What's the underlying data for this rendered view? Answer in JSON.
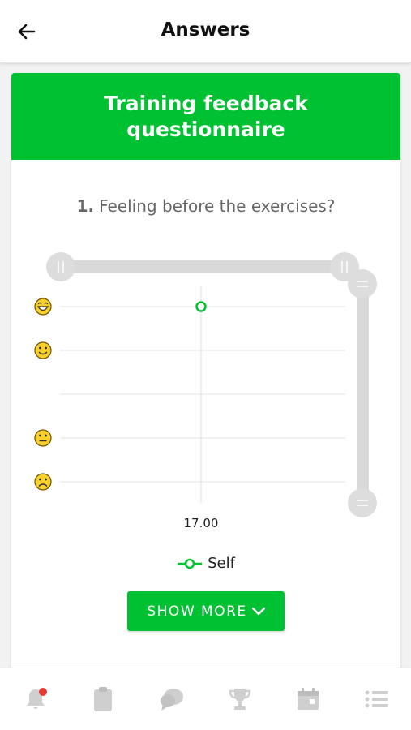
{
  "header": {
    "title": "Answers",
    "back_icon": "arrow-left-icon"
  },
  "card": {
    "title": "Training feedback questionnaire",
    "accent_color": "#00c132"
  },
  "question": {
    "number": "1.",
    "text": "Feeling before the exercises?"
  },
  "chart_data": {
    "type": "scatter",
    "x_ticks": [
      "17.00"
    ],
    "y_levels": [
      {
        "icon": "grinning-face-icon"
      },
      {
        "icon": "smiling-face-icon"
      },
      {
        "icon": ""
      },
      {
        "icon": "neutral-face-icon"
      },
      {
        "icon": "frowning-face-icon"
      }
    ],
    "series": [
      {
        "name": "Self",
        "color": "#00c132",
        "points": [
          {
            "x": "17.00",
            "level": 5
          }
        ]
      }
    ],
    "grid": true,
    "legend_position": "bottom"
  },
  "legend": {
    "label": "Self"
  },
  "actions": {
    "show_more_label": "SHOW MORE"
  },
  "bottom_nav": {
    "items": [
      {
        "icon": "bell-icon",
        "badge": true
      },
      {
        "icon": "clipboard-icon",
        "badge": false
      },
      {
        "icon": "chat-icon",
        "badge": false
      },
      {
        "icon": "trophy-icon",
        "badge": false
      },
      {
        "icon": "calendar-icon",
        "badge": false
      },
      {
        "icon": "list-icon",
        "badge": false
      }
    ]
  }
}
